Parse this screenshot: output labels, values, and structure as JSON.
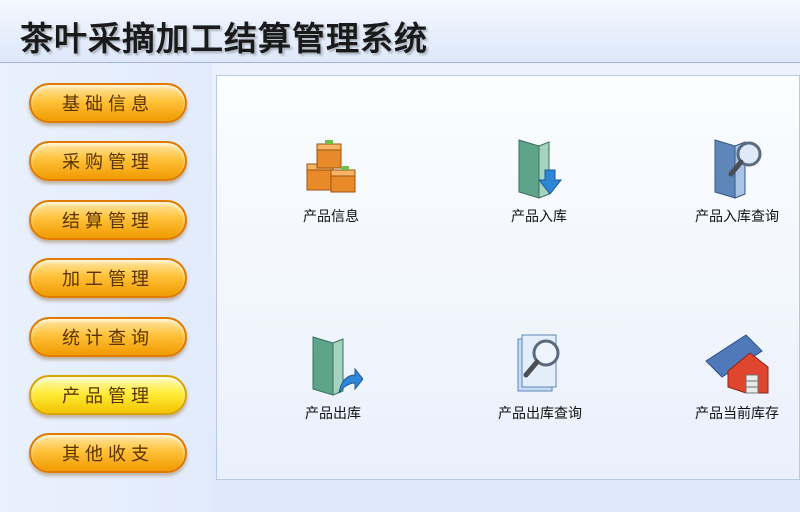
{
  "header": {
    "title": "茶叶采摘加工结算管理系统"
  },
  "sidebar": {
    "items": [
      {
        "label": "基础信息"
      },
      {
        "label": "采购管理"
      },
      {
        "label": "结算管理"
      },
      {
        "label": "加工管理"
      },
      {
        "label": "统计查询"
      },
      {
        "label": "产品管理",
        "active": true
      },
      {
        "label": "其他收支"
      }
    ]
  },
  "main": {
    "tiles": [
      {
        "label": "产品信息",
        "icon": "boxes-icon"
      },
      {
        "label": "产品入库",
        "icon": "folder-arrow-in-icon"
      },
      {
        "label": "产品入库查询",
        "icon": "folder-search-icon"
      },
      {
        "label": "产品出库",
        "icon": "folder-arrow-out-icon"
      },
      {
        "label": "产品出库查询",
        "icon": "document-search-icon"
      },
      {
        "label": "产品当前库存",
        "icon": "warehouse-icon"
      }
    ]
  },
  "colors": {
    "button_orange": "#ffb000",
    "button_active": "#ffe000",
    "header_bg": "#e6eefb"
  }
}
